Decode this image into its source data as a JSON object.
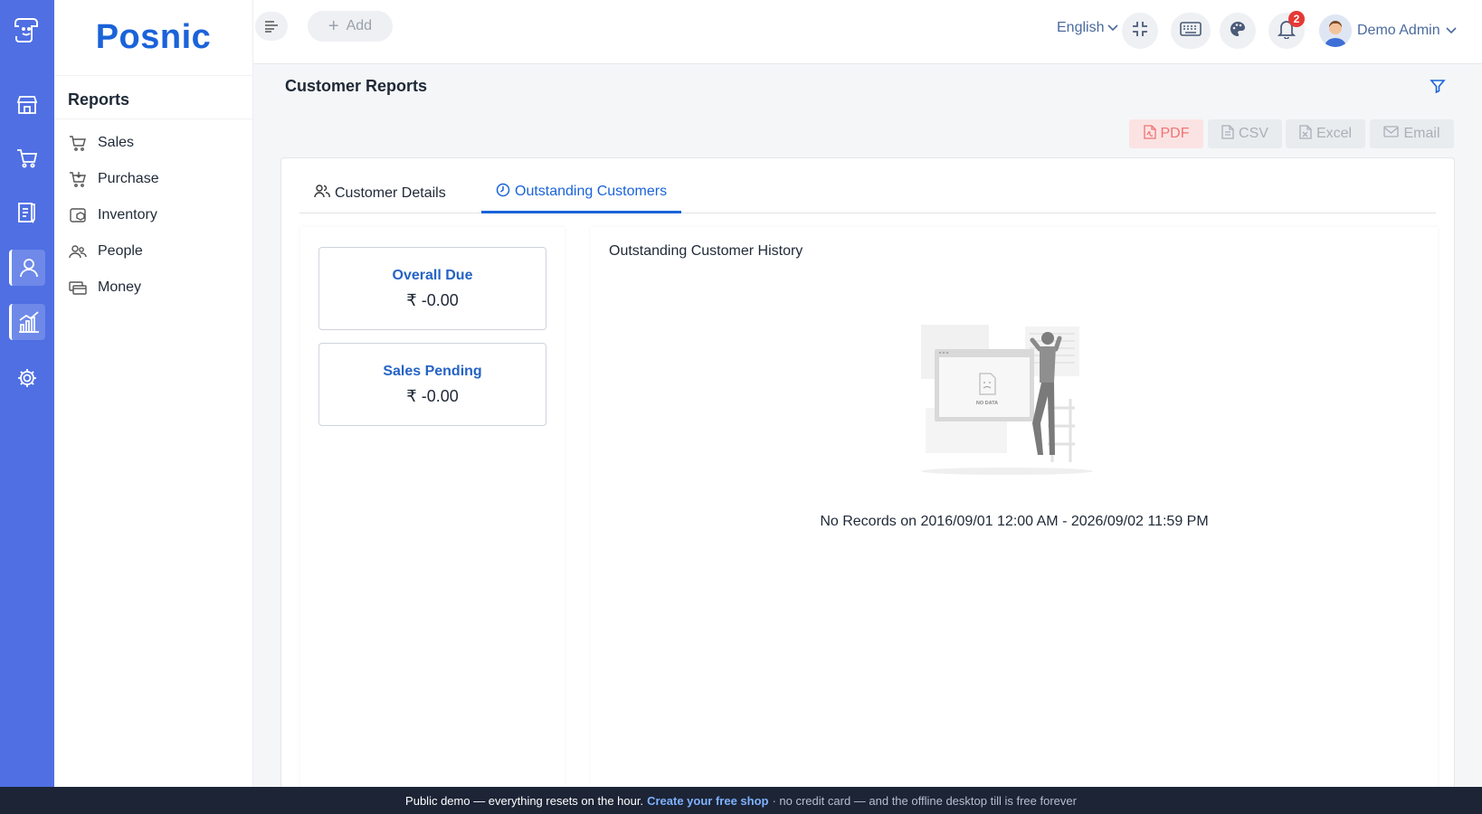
{
  "brand": {
    "name": "Posnic"
  },
  "sidebar": {
    "title": "Reports",
    "items": [
      {
        "label": "Sales",
        "icon": "basket-icon"
      },
      {
        "label": "Purchase",
        "icon": "cart-icon"
      },
      {
        "label": "Inventory",
        "icon": "box-icon"
      },
      {
        "label": "People",
        "icon": "people-icon"
      },
      {
        "label": "Money",
        "icon": "money-icon"
      }
    ]
  },
  "rail": {
    "items": [
      "store-icon",
      "basket-icon",
      "clipboard-icon",
      "person-icon",
      "chart-icon",
      "gear-icon"
    ],
    "active": [
      "person-icon",
      "chart-icon"
    ]
  },
  "topbar": {
    "add_label": "Add",
    "language": "English",
    "notification_count": "2",
    "user_name": "Demo Admin"
  },
  "page": {
    "title": "Customer Reports",
    "exports": {
      "pdf": "PDF",
      "csv": "CSV",
      "excel": "Excel",
      "email": "Email"
    }
  },
  "tabs": {
    "customer_details": "Customer Details",
    "outstanding_customers": "Outstanding Customers",
    "active": "outstanding_customers"
  },
  "stats": {
    "overall_due": {
      "label": "Overall Due",
      "value": "₹ -0.00"
    },
    "sales_pending": {
      "label": "Sales Pending",
      "value": "₹ -0.00"
    }
  },
  "history": {
    "title": "Outstanding Customer History",
    "nodata_art_text": "NO DATA",
    "empty_message": "No Records on 2016/09/01 12:00 AM - 2026/09/02 11:59 PM"
  },
  "banner": {
    "text1": "Public demo — everything resets on the hour.",
    "link": "Create your free shop",
    "text2": "· no credit card — and the offline desktop till is free forever"
  },
  "colors": {
    "rail": "#4f6fe3",
    "brand": "#1a63d9",
    "accent": "#1a63d9",
    "pdf": "#ef7373",
    "badge": "#e53935"
  }
}
